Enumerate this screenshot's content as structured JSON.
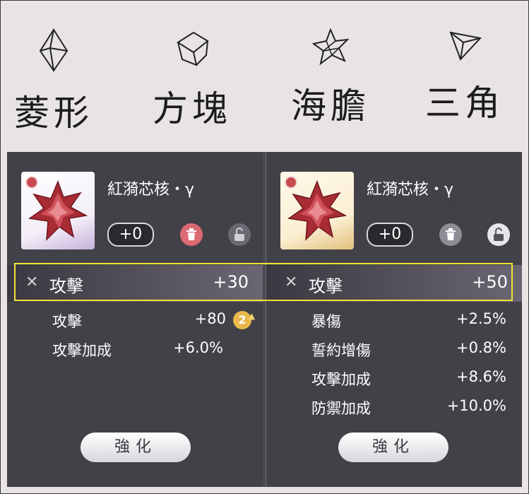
{
  "legend": {
    "items": [
      {
        "label": "菱形",
        "icon": "rhombus-crystal-icon"
      },
      {
        "label": "方塊",
        "icon": "cube-icon"
      },
      {
        "label": "海膽",
        "icon": "urchin-star-icon"
      },
      {
        "label": "三角",
        "icon": "triangle-pyramid-icon"
      }
    ]
  },
  "left_card": {
    "item_name": "紅漪芯核・γ",
    "level": "+0",
    "main_stat": {
      "name": "攻擊",
      "value": "+30"
    },
    "sub_stats": [
      {
        "name": "攻擊",
        "value": "+80",
        "badge": "2"
      },
      {
        "name": "攻擊加成",
        "value": "+6.0%"
      }
    ],
    "enhance_label": "強化"
  },
  "right_card": {
    "item_name": "紅漪芯核・γ",
    "level": "+0",
    "main_stat": {
      "name": "攻擊",
      "value": "+50"
    },
    "sub_stats": [
      {
        "name": "暴傷",
        "value": "+2.5%"
      },
      {
        "name": "誓約增傷",
        "value": "+0.8%"
      },
      {
        "name": "攻擊加成",
        "value": "+8.6%"
      },
      {
        "name": "防禦加成",
        "value": "+10.0%"
      }
    ],
    "enhance_label": "強化"
  },
  "colors": {
    "highlight": "#f2e23a",
    "delete_active": "#dc6a72",
    "upgrade_badge": "#e9b94a"
  }
}
